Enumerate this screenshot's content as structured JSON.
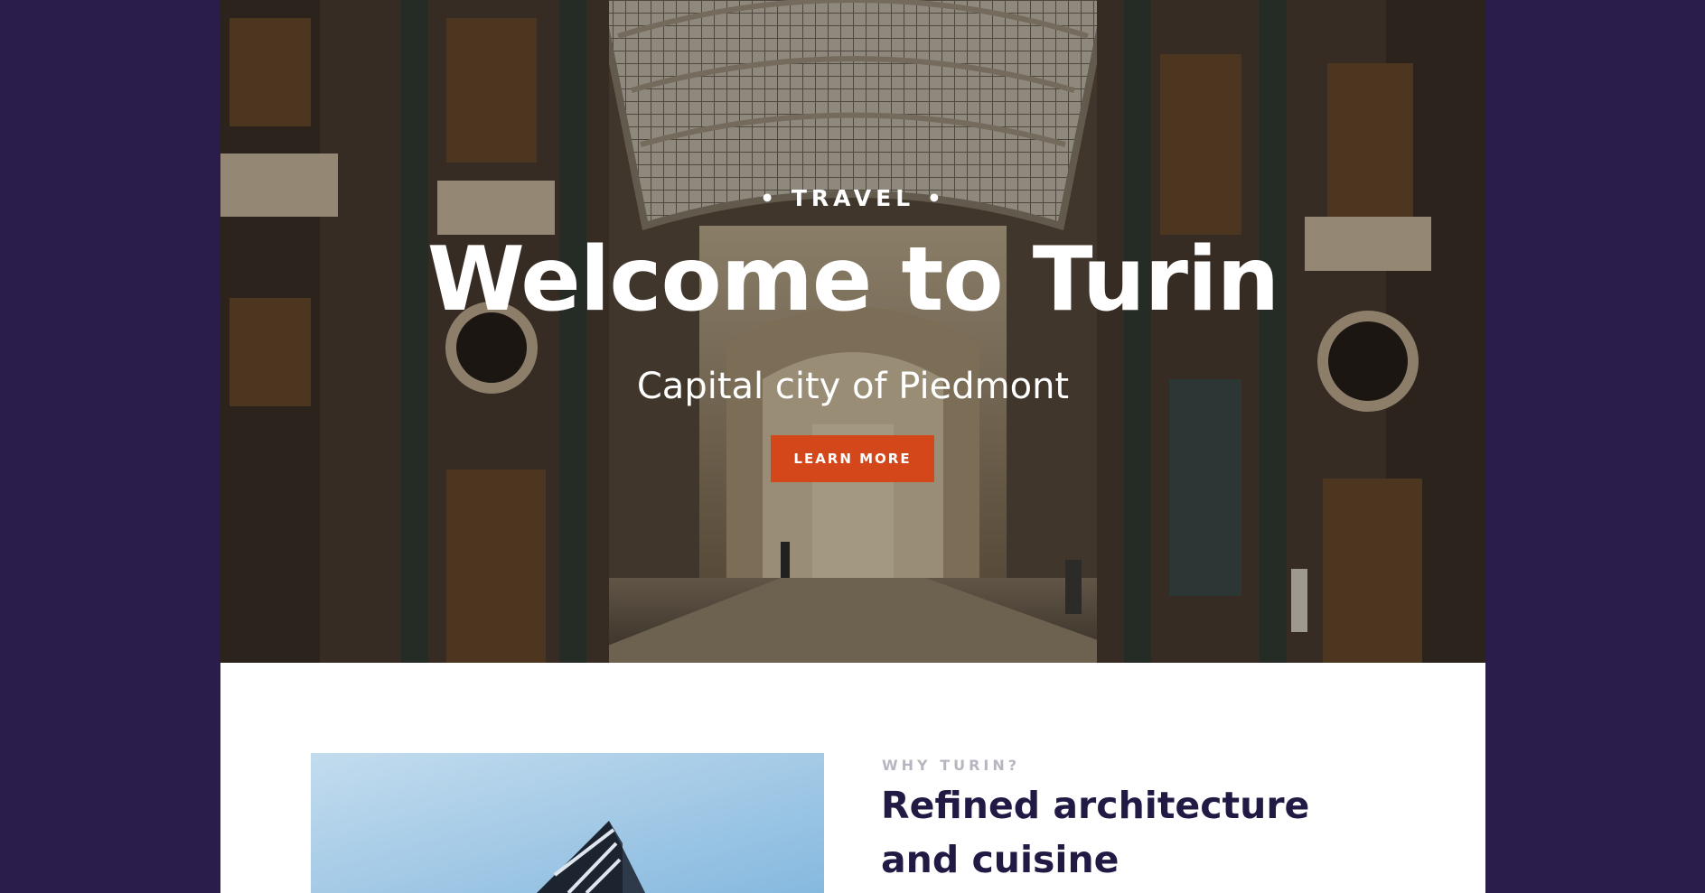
{
  "hero": {
    "eyebrow": "• TRAVEL •",
    "title": "Welcome to Turin",
    "subtitle": "Capital city of Piedmont",
    "button_label": "LEARN MORE",
    "button_color": "#d4471b"
  },
  "feature": {
    "eyebrow": "WHY TURIN?",
    "heading": "Refined architecture and cuisine"
  },
  "colors": {
    "outer_background": "#2a1d4c",
    "heading_text": "#221a45",
    "eyebrow_text": "#b9b5c0"
  }
}
